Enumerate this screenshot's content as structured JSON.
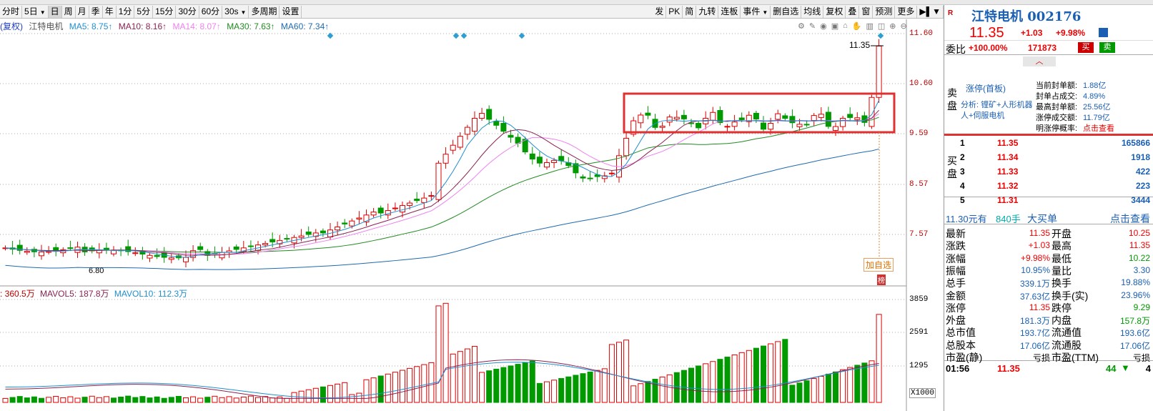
{
  "toolbar": {
    "periods": [
      "分时",
      "5日",
      "日",
      "周",
      "月",
      "季",
      "年",
      "1分",
      "5分",
      "15分",
      "30分",
      "60分",
      "30s",
      "多周期",
      "设置"
    ],
    "active": "日",
    "right": [
      "发",
      "PK",
      "简",
      "九转",
      "连板",
      "事件",
      "删自选",
      "均线",
      "复权",
      "叠",
      "窗",
      "预测",
      "更多"
    ]
  },
  "ma": {
    "prefix": "(复权)",
    "name": "江特电机",
    "ma5": "MA5: 8.75↑",
    "ma10": "MA10: 8.16↑",
    "ma14": "MA14: 8.07↑",
    "ma30": "MA30: 7.63↑",
    "ma60": "MA60: 7.34↑"
  },
  "axis": {
    "price": [
      "11.60",
      "10.60",
      "9.59",
      "8.57",
      "7.57"
    ],
    "vol": [
      "3859",
      "2591",
      "1295",
      "X1000"
    ]
  },
  "chart": {
    "high_label": "11.35",
    "low_label": "6.80",
    "add_fav": "加自选",
    "badge": "榜"
  },
  "vol": {
    "vol": ": 360.5万",
    "mavol5": "MAVOL5: 187.8万",
    "mavol10": "MAVOL10: 112.3万"
  },
  "colors": {
    "up": "#e00000",
    "down": "#009900",
    "ma5": "#1f8fd0",
    "ma10": "#8b2252",
    "ma14": "#ee82ee",
    "ma30": "#228b22",
    "ma60": "#1e6ab0"
  },
  "panel": {
    "r": "R",
    "name": "江特电机 002176",
    "price": "11.35",
    "change": "+1.03",
    "pct": "+9.98%",
    "wb_label": "委比",
    "wb_pct": "+100.00%",
    "wb_num": "171873",
    "buy": "买",
    "sell": "卖",
    "sell_side": "卖盘",
    "buy_side": "买盘",
    "limit_title": "涨停(首板)",
    "analysis": "分析: 锂矿+人形机器人+伺服电机",
    "seal": [
      [
        "当前封单额:",
        "1.88亿"
      ],
      [
        "封单占成交:",
        "4.89%"
      ],
      [
        "最高封单额:",
        "25.56亿"
      ],
      [
        "涨停成交额:",
        "11.79亿"
      ],
      [
        "明涨停概率:",
        "点击查看"
      ]
    ],
    "bids": [
      [
        "1",
        "11.35",
        "165866"
      ],
      [
        "2",
        "11.34",
        "1918"
      ],
      [
        "3",
        "11.33",
        "422"
      ],
      [
        "4",
        "11.32",
        "223"
      ],
      [
        "5",
        "11.31",
        "3444"
      ]
    ],
    "bigorder": {
      "price": "11.30元有",
      "qty": "840手",
      "label": "大买单",
      "link": "点击查看"
    },
    "stats": [
      [
        "最新",
        "11.35",
        "开盘",
        "10.25"
      ],
      [
        "涨跌",
        "+1.03",
        "最高",
        "11.35"
      ],
      [
        "涨幅",
        "+9.98%",
        "最低",
        "10.22"
      ],
      [
        "振幅",
        "10.95%",
        "量比",
        "3.30"
      ],
      [
        "总手",
        "339.1万",
        "换手",
        "19.88%"
      ],
      [
        "金额",
        "37.63亿",
        "换手(实)",
        "23.96%"
      ],
      [
        "涨停",
        "11.35",
        "跌停",
        "9.29"
      ],
      [
        "外盘",
        "181.3万",
        "内盘",
        "157.8万"
      ],
      [
        "总市值",
        "193.7亿",
        "流通值",
        "193.6亿"
      ],
      [
        "总股本",
        "17.06亿",
        "流通股",
        "17.06亿"
      ],
      [
        "市盈(静)",
        "亏损",
        "市盈(TTM)",
        "亏损"
      ]
    ],
    "tick": {
      "time": "01:56",
      "price": "11.35",
      "vol": "44",
      "n": "4"
    }
  }
}
